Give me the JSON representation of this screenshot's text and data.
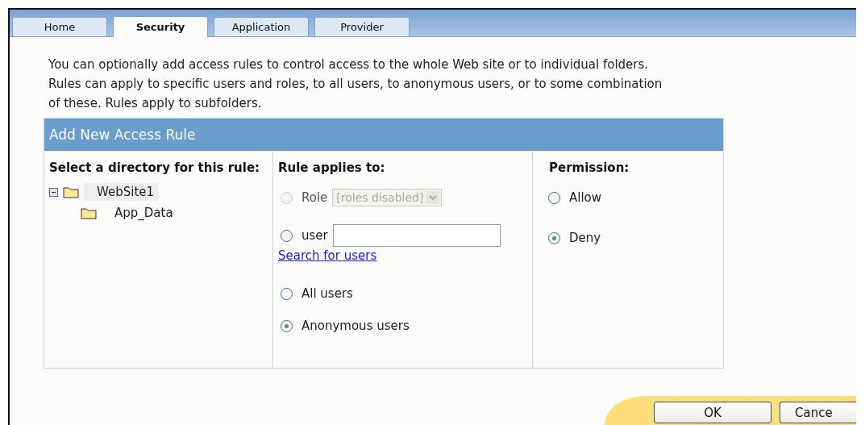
{
  "tabs": [
    {
      "label": "Home",
      "selected": false
    },
    {
      "label": "Security",
      "selected": true
    },
    {
      "label": "Application",
      "selected": false
    },
    {
      "label": "Provider",
      "selected": false
    }
  ],
  "intro": "You can optionally add access rules to control access to the whole Web site or to individual folders. Rules can apply to specific users and roles, to all users, to anonymous users, or to some combination of these. Rules apply to subfolders.",
  "panel": {
    "title": "Add New Access Rule",
    "directory": {
      "heading": "Select a directory for this rule:",
      "tree": [
        {
          "label": "WebSite1",
          "expanded": true,
          "selected": true,
          "children": [
            {
              "label": "App_Data",
              "selected": false
            }
          ]
        }
      ]
    },
    "rule_applies": {
      "heading": "Rule applies to:",
      "options": [
        {
          "kind": "role",
          "label": "Role",
          "selected": false,
          "disabled": true,
          "dropdown_value": "[roles disabled]"
        },
        {
          "kind": "user",
          "label": "user",
          "selected": false,
          "disabled": false,
          "link": "Search for users"
        },
        {
          "kind": "plain",
          "label": "All users",
          "selected": false,
          "disabled": false
        },
        {
          "kind": "plain",
          "label": "Anonymous users",
          "selected": true,
          "disabled": false
        }
      ]
    },
    "permission": {
      "heading": "Permission:",
      "options": [
        {
          "label": "Allow",
          "selected": false
        },
        {
          "label": "Deny",
          "selected": true
        }
      ]
    }
  },
  "buttons": [
    "OK",
    "Cance"
  ]
}
